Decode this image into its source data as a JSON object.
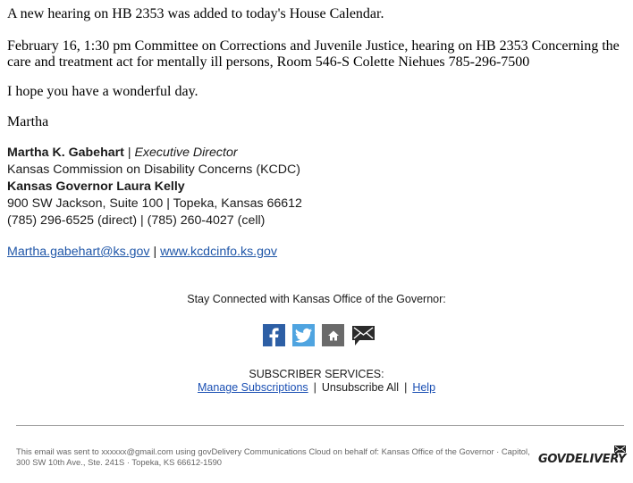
{
  "body": {
    "paragraph1": "A new hearing on HB 2353 was added to today's House Calendar.",
    "paragraph2": "February 16, 1:30 pm Committee on Corrections and Juvenile Justice, hearing on HB 2353 Concerning the care and treatment act for mentally ill persons, Room 546-S Colette Niehues 785-296-7500",
    "paragraph3": "I hope you have a wonderful day.",
    "closing": "Martha"
  },
  "signature": {
    "name": "Martha K. Gabehart",
    "divider": " | ",
    "title": "Executive Director",
    "organization": "Kansas Commission on Disability Concerns (KCDC)",
    "governor": "Kansas Governor Laura Kelly",
    "address": "900 SW Jackson, Suite 100 | Topeka, Kansas 66612",
    "phones": "(785) 296-6525 (direct) | (785) 260-4027 (cell)",
    "email": "Martha.gabehart@ks.gov",
    "link_divider": " | ",
    "website": "www.kcdcinfo.ks.gov"
  },
  "social": {
    "heading": "Stay Connected with Kansas Office of the Governor:",
    "icons": [
      "facebook-icon",
      "twitter-icon",
      "home-icon",
      "email-icon"
    ]
  },
  "subscriber": {
    "heading": "SUBSCRIBER SERVICES:",
    "manage": "Manage Subscriptions",
    "sep": "|",
    "unsubscribe": "Unsubscribe All",
    "help": "Help"
  },
  "footer": {
    "text": "This email was sent to xxxxxx@gmail.com using govDelivery Communications Cloud on behalf of: Kansas Office of the Governor · Capitol, 300 SW 10th Ave., Ste. 241S · Topeka, KS 66612-1590",
    "logo": "GOVDELIVERY"
  }
}
